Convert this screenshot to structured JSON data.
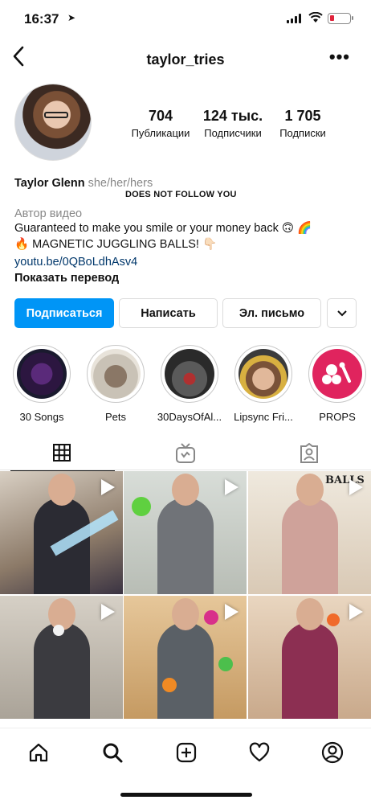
{
  "status_bar": {
    "time": "16:37"
  },
  "header": {
    "username": "taylor_tries"
  },
  "stats": [
    {
      "value": "704",
      "label": "Публикации"
    },
    {
      "value": "124 тыс.",
      "label": "Подписчики"
    },
    {
      "value": "1 705",
      "label": "Подписки"
    }
  ],
  "profile": {
    "name": "Taylor Glenn",
    "pronouns": "she/her/hers",
    "follow_status": "DOES NOT FOLLOW YOU",
    "category": "Автор видео",
    "bio_line1": "Guaranteed to make you smile or your money back 🙃 🌈",
    "bio_line2": "🔥 MAGNETIC JUGGLING BALLS! 👇🏻",
    "link": "youtu.be/0QBoLdhAsv4",
    "translate": "Показать перевод"
  },
  "buttons": {
    "follow": "Подписаться",
    "message": "Написать",
    "email": "Эл. письмо"
  },
  "highlights": [
    {
      "label": "30 Songs"
    },
    {
      "label": "Pets"
    },
    {
      "label": "30DaysOfAl..."
    },
    {
      "label": "Lipsync Fri..."
    },
    {
      "label": "PROPS"
    }
  ],
  "grid_text": {
    "balls": "BALLS"
  },
  "colors": {
    "accent": "#0095f6",
    "link": "#00376b",
    "props": "#e0245e"
  },
  "icons": [
    "back-icon",
    "more-icon",
    "grid-icon",
    "igtv-icon",
    "tagged-icon",
    "home-icon",
    "search-icon",
    "add-icon",
    "heart-icon",
    "profile-icon"
  ]
}
